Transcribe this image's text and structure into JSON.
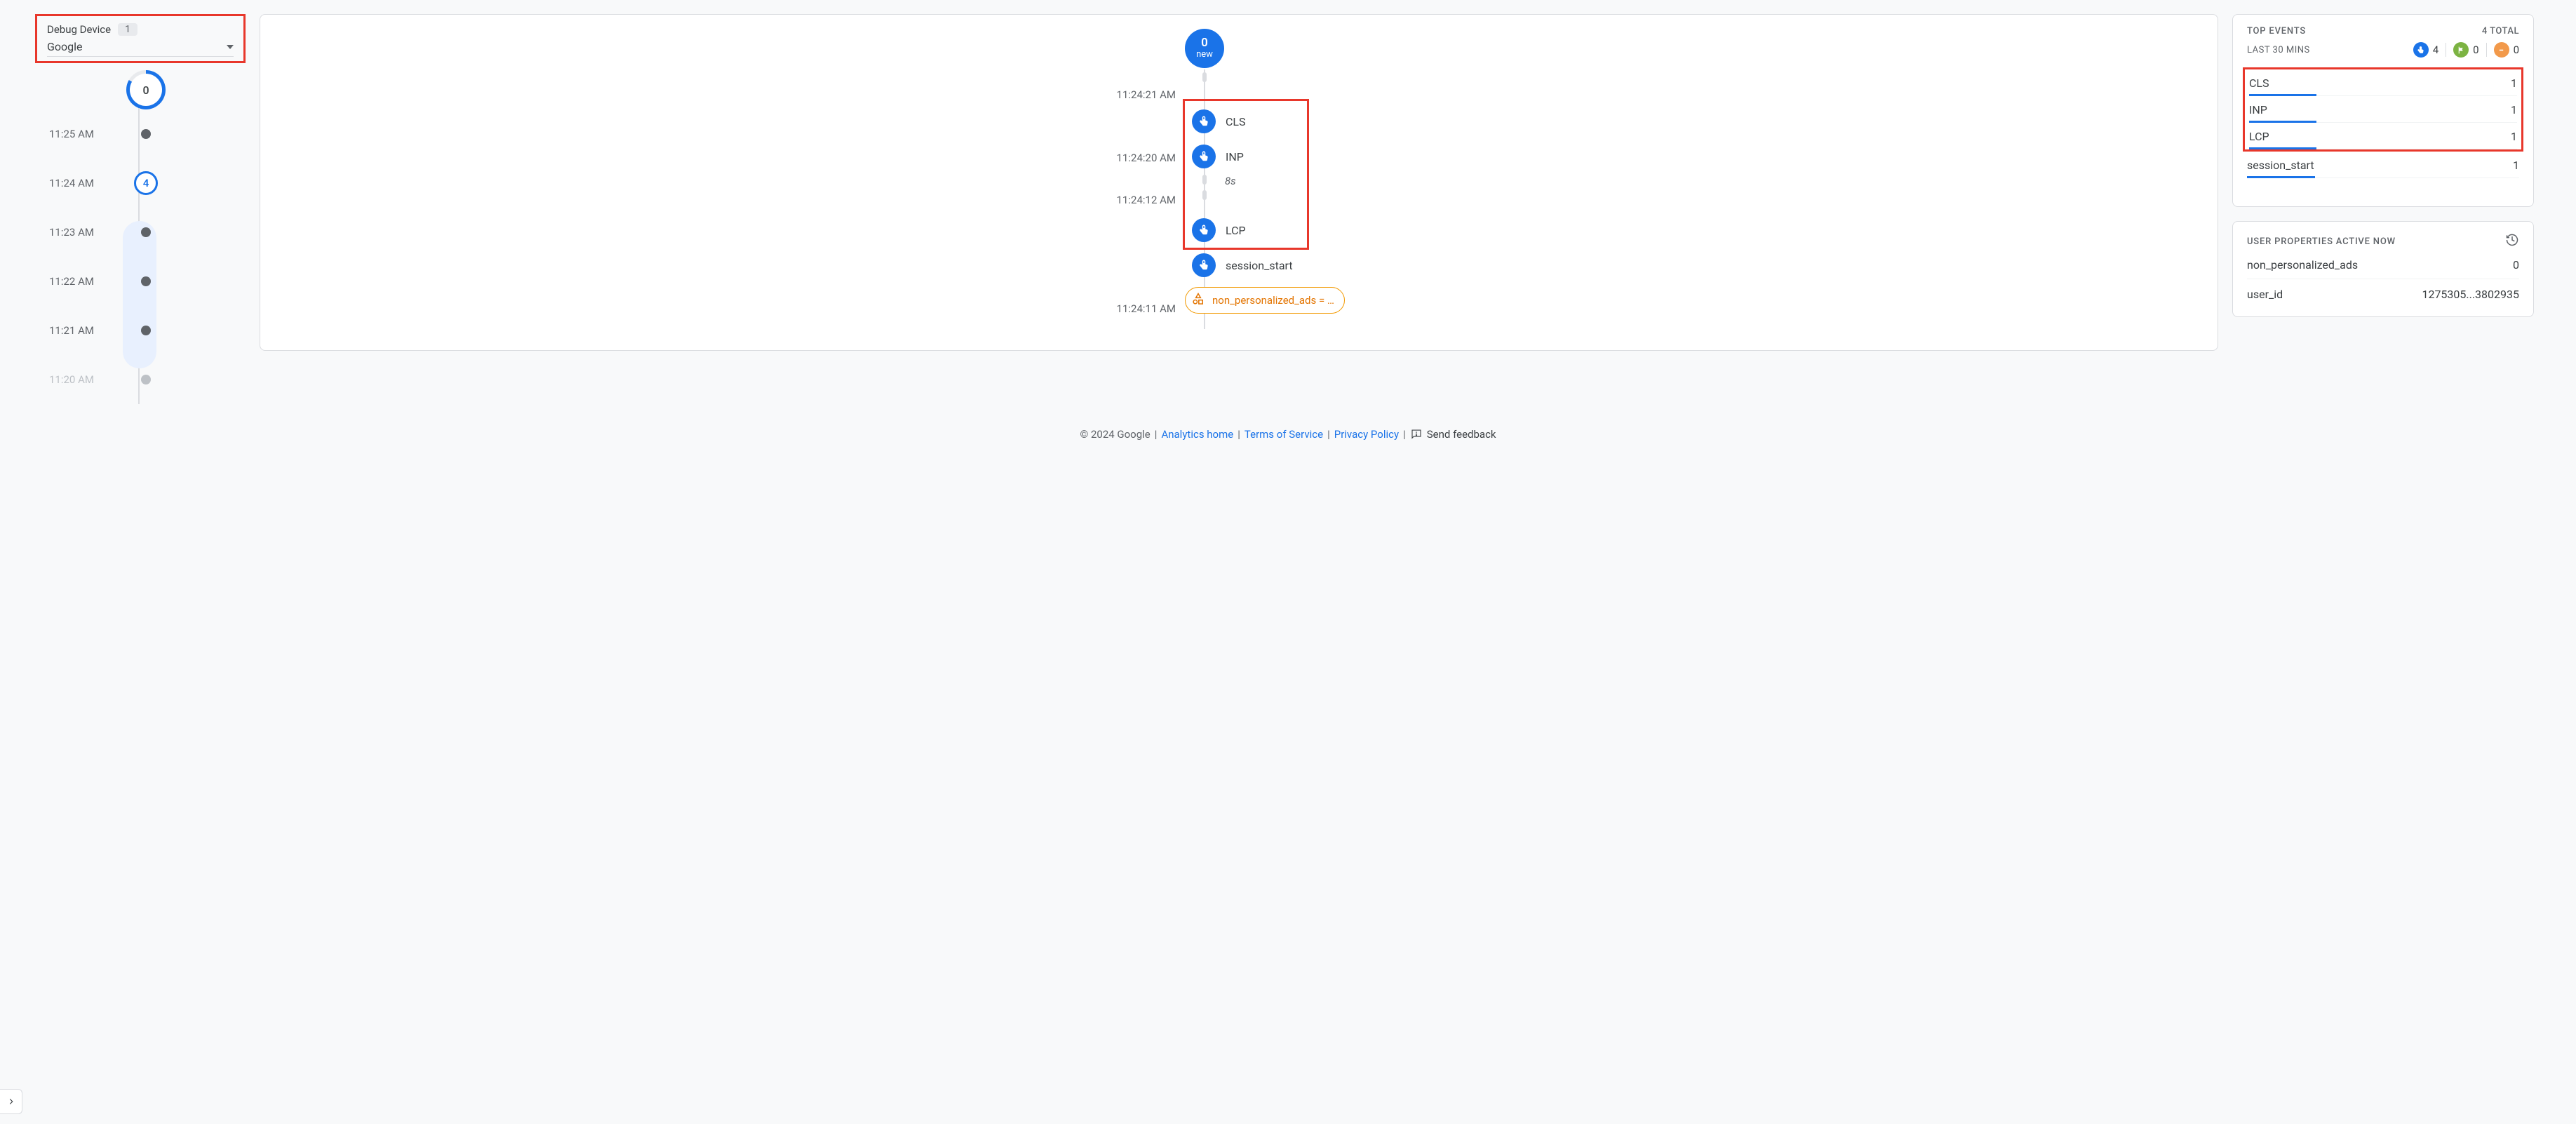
{
  "device": {
    "label": "Debug Device",
    "count": "1",
    "selected": "Google"
  },
  "summary_circle": "0",
  "minutes": [
    {
      "time": "11:25 AM"
    },
    {
      "time": "11:24 AM",
      "count": "4",
      "selected": true
    },
    {
      "time": "11:23 AM"
    },
    {
      "time": "11:22 AM"
    },
    {
      "time": "11:21 AM"
    },
    {
      "time": "11:20 AM",
      "faded": true
    }
  ],
  "stream": {
    "new_count": "0",
    "new_label": "new",
    "times": {
      "t1": "11:24:21 AM",
      "t2": "11:24:20 AM",
      "t3": "11:24:12 AM",
      "t4": "11:24:11 AM"
    },
    "events": {
      "e1": "CLS",
      "e2": "INP",
      "gap": "8s",
      "e3": "LCP",
      "e4": "session_start"
    },
    "pill": "non_personalized_ads = …"
  },
  "top_events": {
    "title": "TOP EVENTS",
    "total": "4 TOTAL",
    "subtitle": "LAST 30 MINS",
    "counts": {
      "blue": "4",
      "green": "0",
      "orange": "0"
    },
    "rows": [
      {
        "name": "CLS",
        "value": "1",
        "bar": 25
      },
      {
        "name": "INP",
        "value": "1",
        "bar": 25
      },
      {
        "name": "LCP",
        "value": "1",
        "bar": 25
      },
      {
        "name": "session_start",
        "value": "1",
        "bar": 25
      }
    ]
  },
  "user_props": {
    "title": "USER PROPERTIES ACTIVE NOW",
    "rows": [
      {
        "name": "non_personalized_ads",
        "value": "0"
      },
      {
        "name": "user_id",
        "value": "1275305...3802935"
      }
    ]
  },
  "footer": {
    "copyright": "© 2024 Google",
    "links": {
      "home": "Analytics home",
      "tos": "Terms of Service",
      "privacy": "Privacy Policy"
    },
    "feedback": "Send feedback"
  }
}
